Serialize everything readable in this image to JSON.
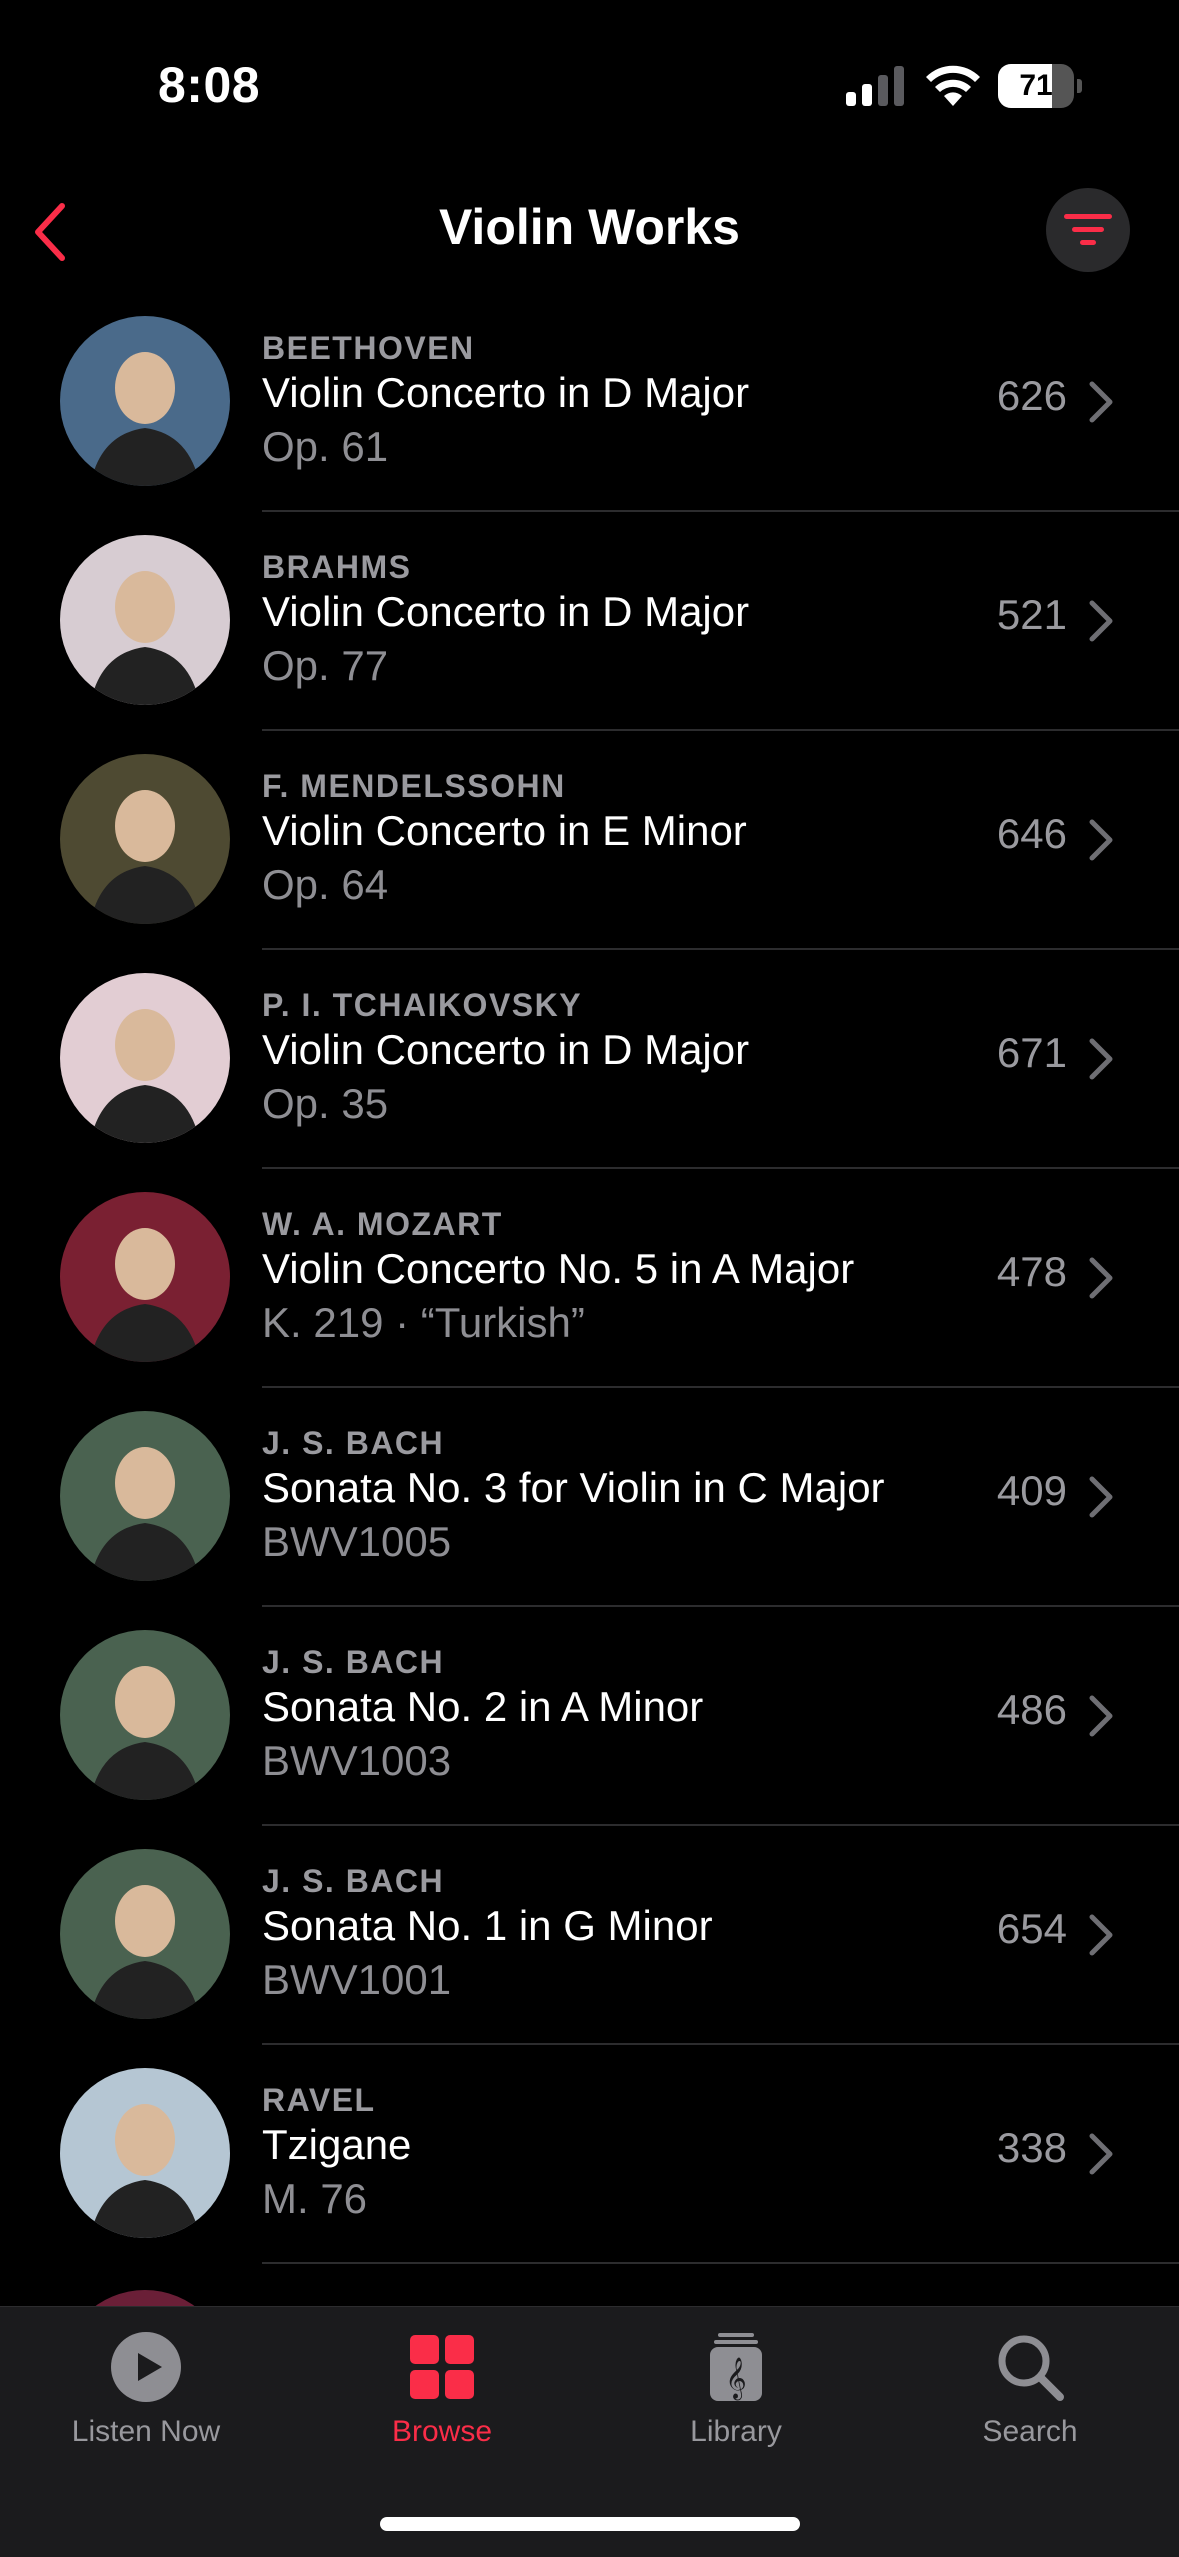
{
  "status_bar": {
    "time": "8:08",
    "battery_level": "71",
    "battery_fraction": 0.71
  },
  "nav": {
    "title": "Violin Works",
    "back_icon": "chevron-left-icon",
    "filter_icon": "filter-lines-icon",
    "accent_color": "#fa2d48"
  },
  "works": [
    {
      "composer": "BEETHOVEN",
      "title": "Violin Concerto in D Major",
      "catalog": "Op. 61",
      "count": "626",
      "avatar_color": "#4a6a8a"
    },
    {
      "composer": "BRAHMS",
      "title": "Violin Concerto in D Major",
      "catalog": "Op. 77",
      "count": "521",
      "avatar_color": "#d7ccd2"
    },
    {
      "composer": "F. MENDELSSOHN",
      "title": "Violin Concerto in E Minor",
      "catalog": "Op. 64",
      "count": "646",
      "avatar_color": "#4e4a32"
    },
    {
      "composer": "P. I. TCHAIKOVSKY",
      "title": "Violin Concerto in D Major",
      "catalog": "Op. 35",
      "count": "671",
      "avatar_color": "#e2cdd3"
    },
    {
      "composer": "W. A. MOZART",
      "title": "Violin Concerto No. 5 in A Major",
      "catalog": "K. 219 · “Turkish”",
      "count": "478",
      "avatar_color": "#7a2032"
    },
    {
      "composer": "J. S. BACH",
      "title": "Sonata No. 3 for Violin in C Major",
      "catalog": "BWV1005",
      "count": "409",
      "avatar_color": "#4a6250"
    },
    {
      "composer": "J. S. BACH",
      "title": "Sonata No. 2 in A Minor",
      "catalog": "BWV1003",
      "count": "486",
      "avatar_color": "#4a6250"
    },
    {
      "composer": "J. S. BACH",
      "title": "Sonata No. 1 in G Minor",
      "catalog": "BWV1001",
      "count": "654",
      "avatar_color": "#4a6250"
    },
    {
      "composer": "RAVEL",
      "title": "Tzigane",
      "catalog": "M. 76",
      "count": "338",
      "avatar_color": "#b5c6d3"
    }
  ],
  "tabs": [
    {
      "label": "Listen Now",
      "icon": "play-circle-icon",
      "active": false
    },
    {
      "label": "Browse",
      "icon": "grid-icon",
      "active": true
    },
    {
      "label": "Library",
      "icon": "music-library-icon",
      "active": false
    },
    {
      "label": "Search",
      "icon": "search-icon",
      "active": false
    }
  ]
}
